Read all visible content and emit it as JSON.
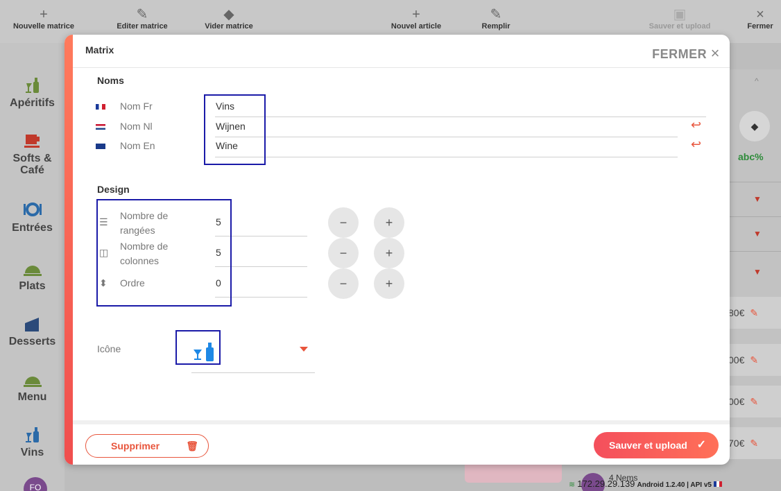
{
  "toolbar": {
    "items": [
      {
        "label": "Nouvelle matrice",
        "icon": "plus-icon"
      },
      {
        "label": "Editer matrice",
        "icon": "pencil-icon"
      },
      {
        "label": "Vider matrice",
        "icon": "eraser-icon"
      },
      {
        "label": "Nouvel article",
        "icon": "plus-icon"
      },
      {
        "label": "Remplir",
        "icon": "pencil-icon"
      },
      {
        "label": "Sauver et upload",
        "icon": "save-icon"
      },
      {
        "label": "Fermer",
        "icon": "close-icon"
      }
    ]
  },
  "sidebar": {
    "items": [
      {
        "label": "Apéritifs",
        "icon": "wine-glass-bottle-icon"
      },
      {
        "label": "Softs & Café",
        "icon": "coffee-cup-icon"
      },
      {
        "label": "Entrées",
        "icon": "plate-cutlery-icon"
      },
      {
        "label": "Plats",
        "icon": "cloche-icon"
      },
      {
        "label": "Desserts",
        "icon": "cake-slice-icon"
      },
      {
        "label": "Menu",
        "icon": "cloche-icon"
      },
      {
        "label": "Vins",
        "icon": "wine-glass-bottle-icon"
      }
    ],
    "avatar": "FO"
  },
  "right_panel": {
    "abc": "abc%",
    "prices": [
      "80€",
      "00€",
      "00€",
      "70€"
    ]
  },
  "status": {
    "ip": "172.29.29.139",
    "build": "Android 1.2.40 | API v5",
    "item": "4 Nems"
  },
  "modal": {
    "title": "Matrix",
    "close_label": "FERMER",
    "names_title": "Noms",
    "names": [
      {
        "label": "Nom Fr",
        "value": "Vins",
        "flag": "fr"
      },
      {
        "label": "Nom Nl",
        "value": "Wijnen",
        "flag": "nl"
      },
      {
        "label": "Nom En",
        "value": "Wine",
        "flag": "en"
      }
    ],
    "design_title": "Design",
    "design": [
      {
        "label": "Nombre de rangées",
        "value": "5",
        "icon": "list-icon"
      },
      {
        "label": "Nombre de colonnes",
        "value": "5",
        "icon": "columns-icon"
      },
      {
        "label": "Ordre",
        "value": "0",
        "icon": "sort-icon"
      }
    ],
    "icon_label": "Icône",
    "icon_value": "wine-glass-bottle-icon",
    "delete_label": "Supprimer",
    "save_label": "Sauver et upload"
  },
  "colors": {
    "accent": "#e8553c",
    "highlight": "#1a1aa8",
    "icon_blue": "#1e88e5"
  }
}
